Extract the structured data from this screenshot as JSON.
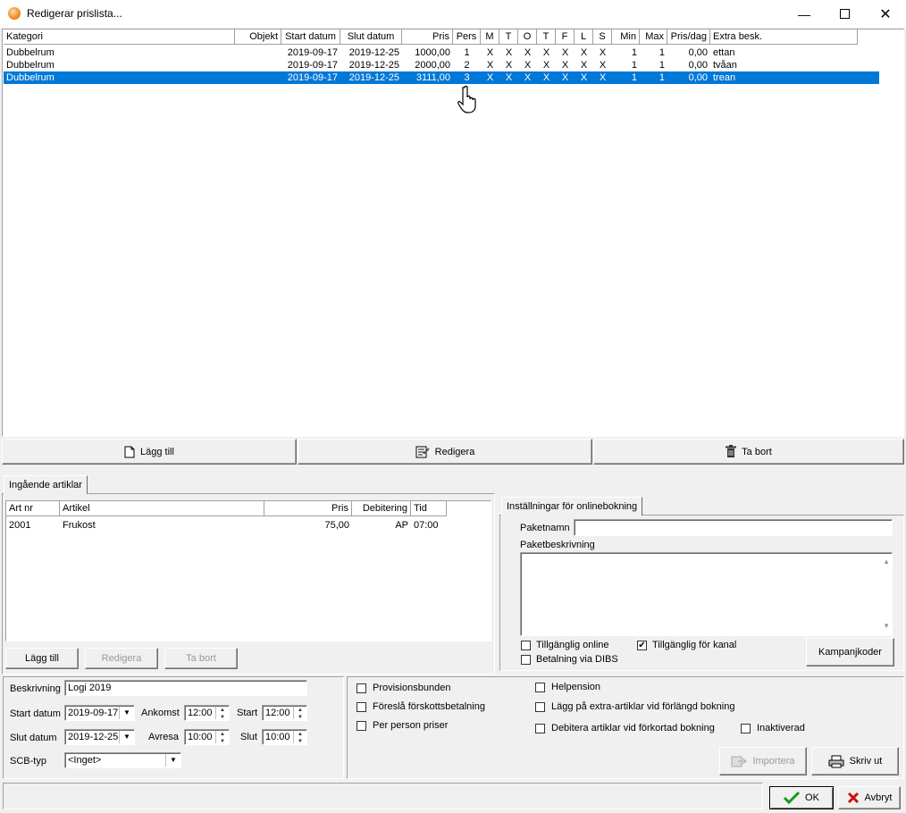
{
  "window": {
    "title": "Redigerar prislista..."
  },
  "pricelist": {
    "columns": [
      "Kategori",
      "Objekt",
      "Start datum",
      "Slut datum",
      "Pris",
      "Pers",
      "M",
      "T",
      "O",
      "T",
      "F",
      "L",
      "S",
      "Min",
      "Max",
      "Pris/dag",
      "Extra besk."
    ],
    "rows": [
      [
        "Dubbelrum",
        "",
        "2019-09-17",
        "2019-12-25",
        "1000,00",
        "1",
        "X",
        "X",
        "X",
        "X",
        "X",
        "X",
        "X",
        "1",
        "1",
        "0,00",
        "ettan"
      ],
      [
        "Dubbelrum",
        "",
        "2019-09-17",
        "2019-12-25",
        "2000,00",
        "2",
        "X",
        "X",
        "X",
        "X",
        "X",
        "X",
        "X",
        "1",
        "1",
        "0,00",
        "tvåan"
      ],
      [
        "Dubbelrum",
        "",
        "2019-09-17",
        "2019-12-25",
        "3111,00",
        "3",
        "X",
        "X",
        "X",
        "X",
        "X",
        "X",
        "X",
        "1",
        "1",
        "0,00",
        "trean"
      ]
    ]
  },
  "toolbar": {
    "add": "Lägg till",
    "edit": "Redigera",
    "delete": "Ta bort"
  },
  "articles": {
    "tab": "Ingående artiklar",
    "columns": [
      "Art nr",
      "Artikel",
      "Pris",
      "Debitering",
      "Tid"
    ],
    "rows": [
      [
        "2001",
        "Frukost",
        "75,00",
        "AP",
        "07:00"
      ]
    ],
    "add": "Lägg till",
    "edit": "Redigera",
    "delete": "Ta bort"
  },
  "online": {
    "tab": "Inställningar för onlinebokning",
    "package_name_label": "Paketnamn",
    "package_name": "",
    "package_desc_label": "Paketbeskrivning",
    "available_online": "Tillgänglig online",
    "available_channel": "Tillgänglig för kanal",
    "dibs": "Betalning via DIBS",
    "campaign": "Kampanjkoder"
  },
  "form": {
    "desc_label": "Beskrivning",
    "desc": "Logi 2019",
    "start_label": "Start datum",
    "start": "2019-09-17",
    "end_label": "Slut datum",
    "end": "2019-12-25",
    "arrive_label": "Ankomst",
    "arrive": "12:00",
    "depart_label": "Avresa",
    "depart": "10:00",
    "st_label": "Start",
    "st": "12:00",
    "sl_label": "Slut",
    "sl": "10:00",
    "scb_label": "SCB-typ",
    "scb": "<Inget>"
  },
  "options": {
    "provision": "Provisionsbunden",
    "prepay": "Föreslå förskottsbetalning",
    "perperson": "Per person priser",
    "fullboard": "Helpension",
    "extra_longer": "Lägg på extra-artiklar vid förlängd bokning",
    "debit_shorter": "Debitera artiklar vid förkortad bokning",
    "inactive": "Inaktiverad",
    "import": "Importera",
    "print": "Skriv ut"
  },
  "footer": {
    "ok": "OK",
    "cancel": "Avbryt"
  }
}
